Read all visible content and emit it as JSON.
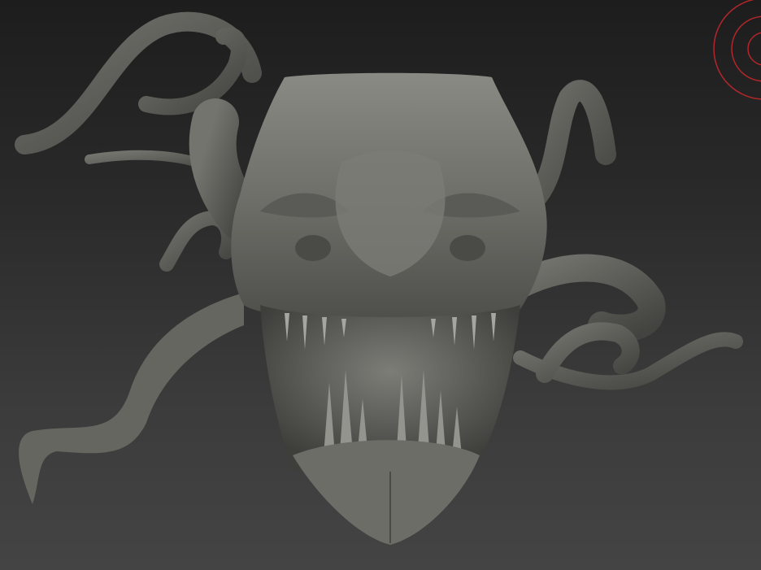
{
  "viewport": {
    "background_top": "#1d1d1d",
    "background_bottom": "#444444",
    "model": "creature-head-sculpt",
    "material_color": "#6f6f6a"
  },
  "gizmo": {
    "icon": "navigation-gizmo-icon",
    "color": "#b3262a"
  }
}
